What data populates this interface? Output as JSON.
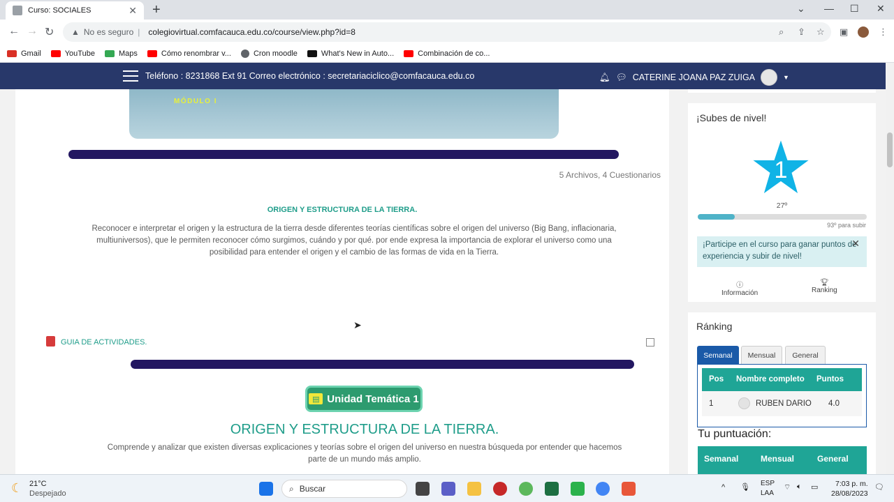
{
  "browser": {
    "tab_title": "Curso: SOCIALES",
    "security": "No es seguro",
    "url": "colegiovirtual.comfacauca.edu.co/course/view.php?id=8",
    "bookmarks": [
      "Gmail",
      "YouTube",
      "Maps",
      "Cómo renombrar v...",
      "Cron moodle",
      "What's New in Auto...",
      "Combinación de co..."
    ]
  },
  "site": {
    "contact": "Teléfono : 8231868 Ext 91  Correo electrónico : secretariaciclico@comfacauca.edu.co",
    "user": "CATERINE JOANA PAZ ZUIGA",
    "banner_label": "MÓDULO I",
    "files_count": "5 Archivos, 4 Cuestionarios",
    "section_title": "ORIGEN Y ESTRUCTURA DE LA TIERRA.",
    "section_text": "Reconocer e interpretar el origen y la estructura de la tierra desde diferentes teorías científicas sobre el origen del universo (Big Bang, inflacionaria, multiuniversos), que le permiten reconocer cómo surgimos, cuándo y por qué. por ende expresa la importancia de explorar el universo como una posibilidad para entender el origen y el cambio de las formas de vida en la Tierra.",
    "guide": "GUIA DE ACTIVIDADES.",
    "unidad": "Unidad Temática 1",
    "unit_title": "ORIGEN Y ESTRUCTURA DE LA TIERRA.",
    "unit_text": "Comprende y analizar que existen diversas explicaciones y teorías sobre el origen del universo en nuestra búsqueda por entender que hacemos parte de un mundo más amplio."
  },
  "level": {
    "title": "¡Subes de nivel!",
    "number": "1",
    "rank_label": "27º",
    "next_label": "93º para subir",
    "progress_fraction": 0.22,
    "alert": "¡Participe en el curso para ganar puntos de experiencia y subir de nivel!",
    "info": "Información",
    "ranking": "Ranking"
  },
  "ranking": {
    "title": "Ránking",
    "tabs": [
      "Semanal",
      "Mensual",
      "General"
    ],
    "headers": [
      "Pos",
      "Nombre completo",
      "Puntos"
    ],
    "row": {
      "pos": "1",
      "name": "RUBEN DARIO",
      "points": "4.0"
    },
    "score_title": "Tu puntuación:",
    "score_tabs": [
      "Semanal",
      "Mensual",
      "General"
    ]
  },
  "taskbar": {
    "temp": "21°C",
    "weather": "Despejado",
    "search": "Buscar",
    "lang": "ESP",
    "lang2": "LAA",
    "time": "7:03 p. m.",
    "date": "28/08/2023"
  }
}
